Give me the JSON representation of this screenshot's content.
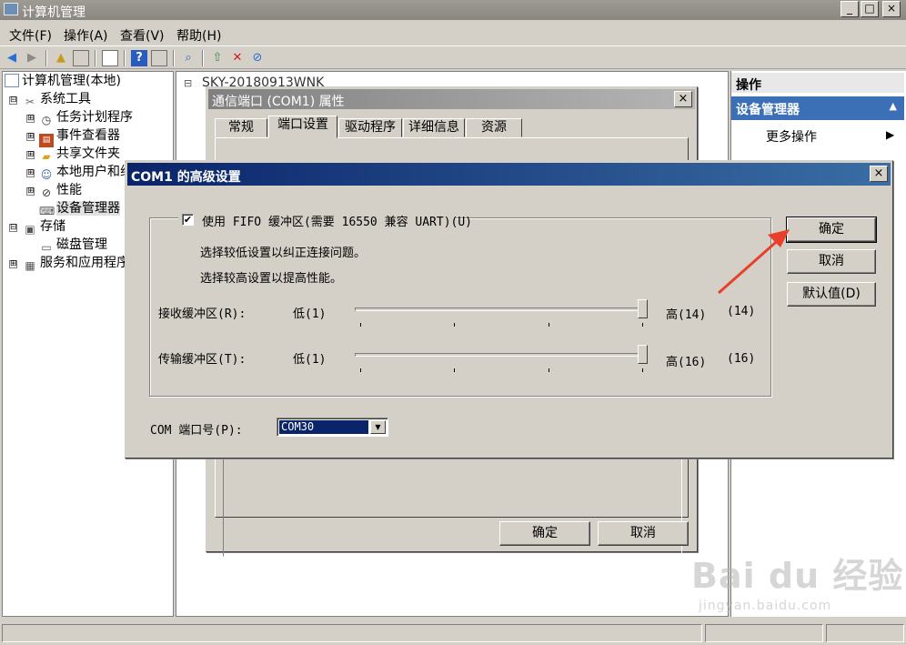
{
  "main_window": {
    "title": "计算机管理",
    "controls": {
      "minimize": "_",
      "maximize": "□",
      "close": "×"
    }
  },
  "menu": [
    "文件(F)",
    "操作(A)",
    "查看(V)",
    "帮助(H)"
  ],
  "tree": {
    "root": "计算机管理(本地)",
    "system_tools": "系统工具",
    "task_scheduler": "任务计划程序",
    "event_viewer": "事件查看器",
    "shared_folders": "共享文件夹",
    "local_users": "本地用户和组",
    "performance": "性能",
    "device_manager": "设备管理器",
    "storage": "存储",
    "disk_management": "磁盘管理",
    "services_apps": "服务和应用程序",
    "expanders": {
      "expanded": "⊟",
      "collapsed": "⊞"
    }
  },
  "content": {
    "computer_name": "SKY-20180913WNK"
  },
  "actions": {
    "header": "操作",
    "section": "设备管理器",
    "collapse_glyph": "▲",
    "more": "更多操作",
    "more_arrow": "▶"
  },
  "prop_dialog": {
    "title": "通信端口 (COM1) 属性",
    "tabs": [
      "常规",
      "端口设置",
      "驱动程序",
      "详细信息",
      "资源"
    ],
    "ok": "确定",
    "cancel": "取消"
  },
  "adv_dialog": {
    "title": "COM1 的高级设置",
    "fifo_label": "使用 FIFO 缓冲区(需要 16550 兼容 UART)(U)",
    "fifo_checked": true,
    "check_glyph": "✔",
    "hint1": "选择较低设置以纠正连接问题。",
    "hint2": "选择较高设置以提高性能。",
    "receive": {
      "label": "接收缓冲区(R):",
      "low": "低(1)",
      "high": "高(14)",
      "value": "(14)",
      "level": 14,
      "max": 14
    },
    "transmit": {
      "label": "传输缓冲区(T):",
      "low": "低(1)",
      "high": "高(16)",
      "value": "(16)",
      "level": 16,
      "max": 16
    },
    "port_label": "COM 端口号(P):",
    "port_value": "COM30",
    "combo_arrow": "▼",
    "ok": "确定",
    "cancel": "取消",
    "defaults": "默认值(D)",
    "close": "×"
  },
  "watermark": {
    "brand": "Bai du 经验",
    "url": "jingyan.baidu.com"
  },
  "colors": {
    "active_title": "#0a246a",
    "inactive_title": "#808080",
    "arrow": "#e8402a",
    "selection": "#0a246a"
  }
}
